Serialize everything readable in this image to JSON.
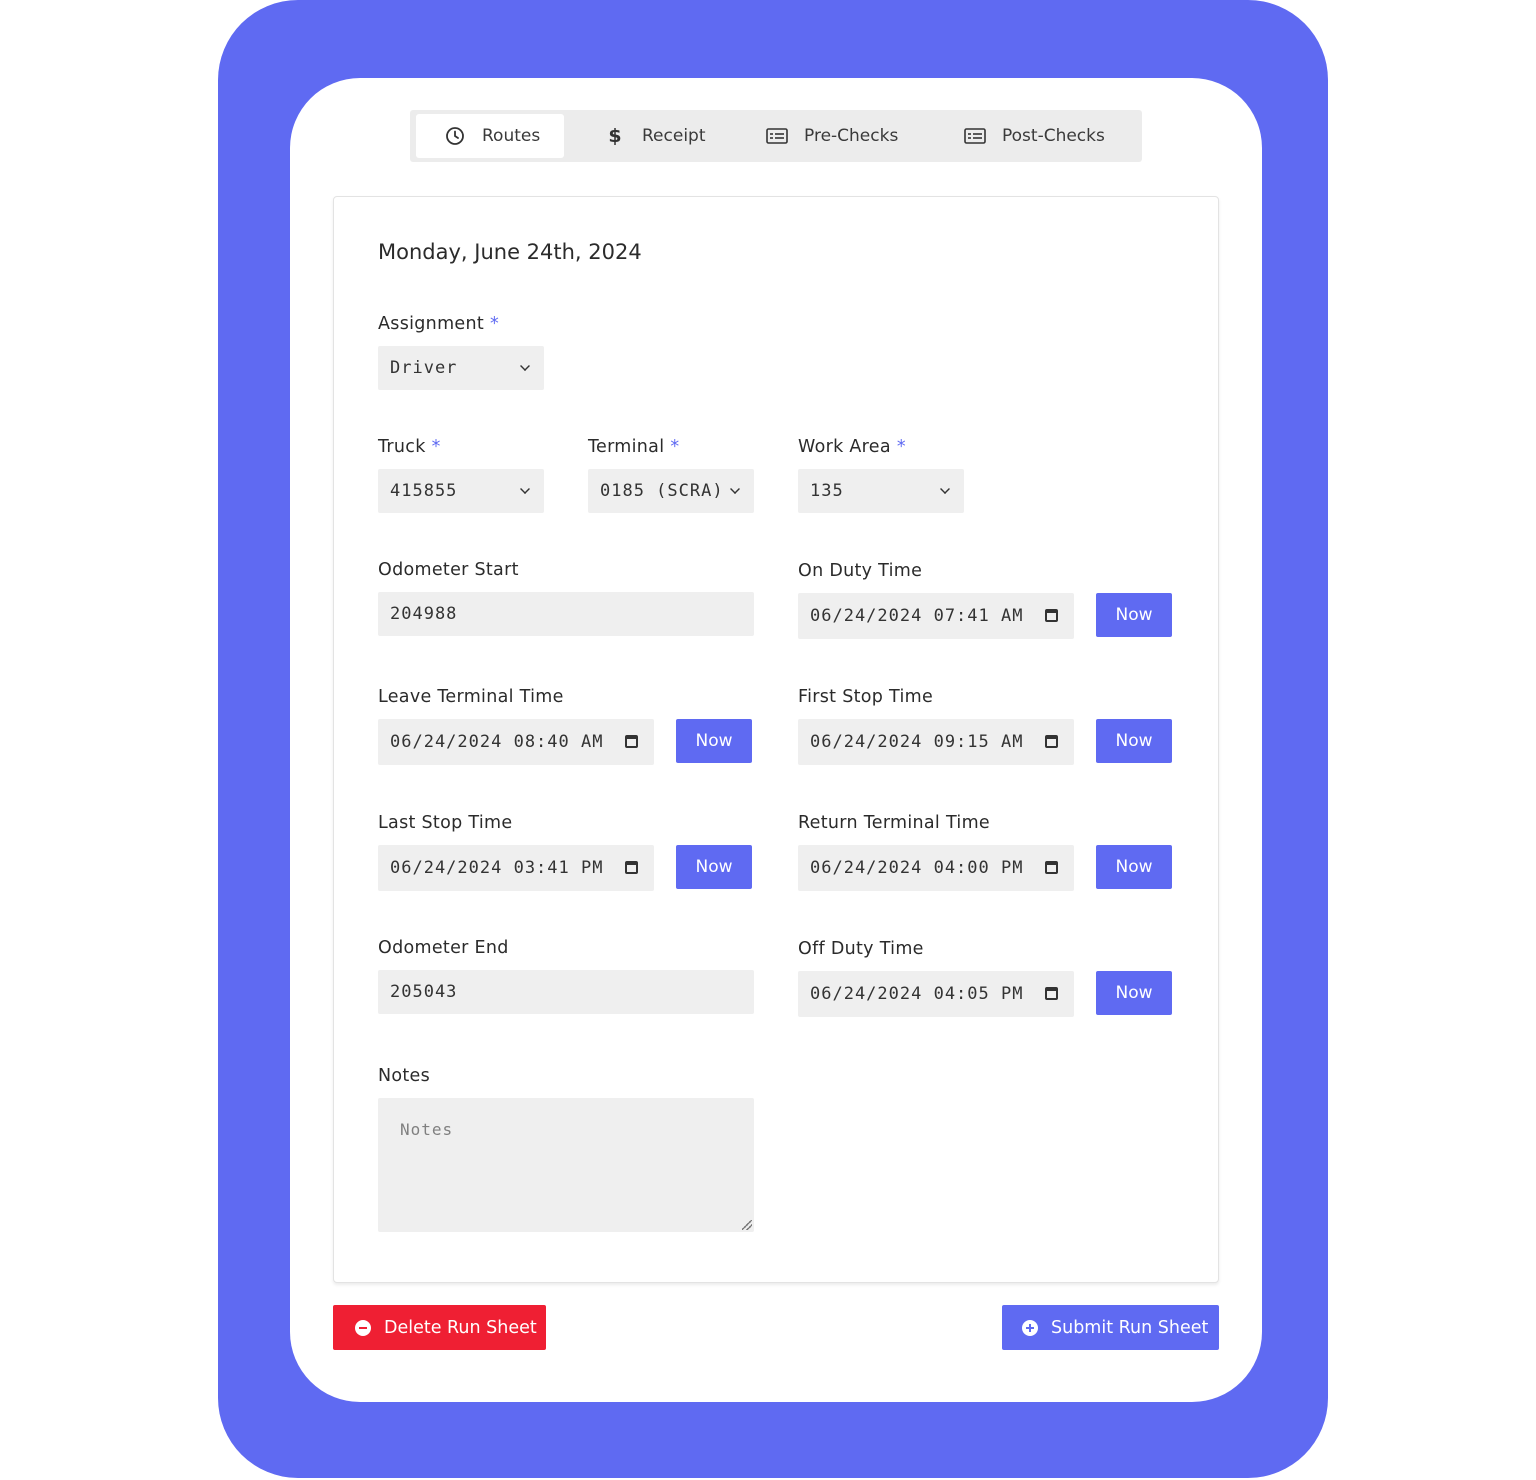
{
  "tabs": [
    {
      "label": "Routes",
      "icon": "clock-icon",
      "active": true
    },
    {
      "label": "Receipt",
      "icon": "dollar-icon",
      "active": false
    },
    {
      "label": "Pre-Checks",
      "icon": "checklist-icon",
      "active": false
    },
    {
      "label": "Post-Checks",
      "icon": "checklist-icon",
      "active": false
    }
  ],
  "date_title": "Monday, June 24th, 2024",
  "required_mark": "*",
  "assignment": {
    "label": "Assignment",
    "value": "Driver"
  },
  "truck": {
    "label": "Truck",
    "value": "415855"
  },
  "terminal": {
    "label": "Terminal",
    "value": "0185 (SCRA)"
  },
  "work_area": {
    "label": "Work Area",
    "value": "135"
  },
  "odometer_start": {
    "label": "Odometer Start",
    "value": "204988"
  },
  "on_duty_time": {
    "label": "On Duty Time",
    "value": "06/24/2024 07:41 AM"
  },
  "leave_terminal_time": {
    "label": "Leave Terminal Time",
    "value": "06/24/2024 08:40 AM"
  },
  "first_stop_time": {
    "label": "First Stop Time",
    "value": "06/24/2024 09:15 AM"
  },
  "last_stop_time": {
    "label": "Last Stop Time",
    "value": "06/24/2024 03:41 PM"
  },
  "return_terminal_time": {
    "label": "Return Terminal Time",
    "value": "06/24/2024 04:00 PM"
  },
  "odometer_end": {
    "label": "Odometer End",
    "value": "205043"
  },
  "off_duty_time": {
    "label": "Off Duty Time",
    "value": "06/24/2024 04:05 PM"
  },
  "now_label": "Now",
  "notes": {
    "label": "Notes",
    "placeholder": "Notes",
    "value": ""
  },
  "actions": {
    "delete_label": "Delete Run Sheet",
    "submit_label": "Submit Run Sheet"
  },
  "colors": {
    "accent": "#5f6af2",
    "danger": "#ef1f33",
    "field_bg": "#efefef"
  }
}
